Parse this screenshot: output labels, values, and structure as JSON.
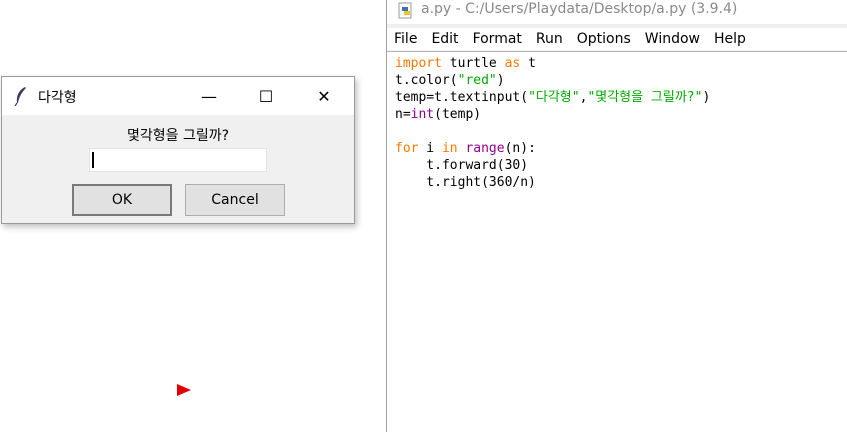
{
  "turtle": {
    "arrow_color": "#e00000"
  },
  "dialog": {
    "title": "다각형",
    "prompt": "몇각형을 그릴까?",
    "input_value": "",
    "ok_label": "OK",
    "cancel_label": "Cancel",
    "minimize_glyph": "—",
    "maximize_glyph": "☐",
    "close_glyph": "✕"
  },
  "editor": {
    "title": "a.py - C:/Users/Playdata/Desktop/a.py (3.9.4)",
    "menu": [
      "File",
      "Edit",
      "Format",
      "Run",
      "Options",
      "Window",
      "Help"
    ],
    "code": {
      "l1_kw1": "import",
      "l1_mid": " turtle ",
      "l1_kw2": "as",
      "l1_end": " t",
      "l2_pre": "t.color(",
      "l2_str": "\"red\"",
      "l2_end": ")",
      "l3_pre": "temp=t.textinput(",
      "l3_str1": "\"다각형\"",
      "l3_sep": ",",
      "l3_str2": "\"몇각형을 그릴까?\"",
      "l3_end": ")",
      "l4_pre": "n=",
      "l4_bi": "int",
      "l4_end": "(temp)",
      "l6_kw1": "for",
      "l6_mid": " i ",
      "l6_kw2": "in",
      "l6_sp": " ",
      "l6_bi": "range",
      "l6_end": "(n):",
      "l7": "    t.forward(30)",
      "l8": "    t.right(360/n)"
    }
  }
}
